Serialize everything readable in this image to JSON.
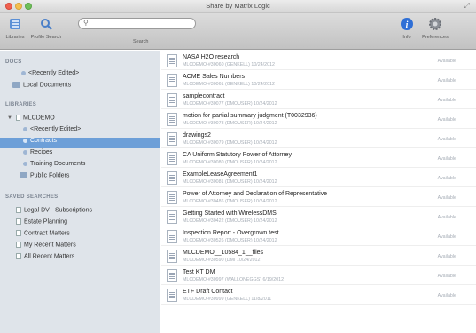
{
  "window": {
    "title": "Share by Matrix Logic"
  },
  "toolbar": {
    "libraries_label": "Libraries",
    "profile_search_label": "Profile Search",
    "search_placeholder": "",
    "search_label": "Search",
    "info_label": "Info",
    "preferences_label": "Preferences"
  },
  "sidebar": {
    "docs_header": "DOCS",
    "docs_items": [
      "<Recently Edited>",
      "Local Documents"
    ],
    "libraries_header": "LIBRARIES",
    "library_root": "MLCDEMO",
    "library_items": [
      "<Recently Edited>",
      "Contracts",
      "Recipes",
      "Training Documents",
      "Public Folders"
    ],
    "selected_item": "Contracts",
    "saved_header": "SAVED SEARCHES",
    "saved_items": [
      "Legal DV - Subscriptions",
      "Estate Planning",
      "Contract Matters",
      "My Recent Matters",
      "All Recent Matters"
    ]
  },
  "documents": [
    {
      "title": "NASA H2O research",
      "meta": "MLCDEMO-#30060 (GENKELL) 10/24/2012",
      "status": "Available"
    },
    {
      "title": "ACME Sales Numbers",
      "meta": "MLCDEMO-#30061 (GENKELL) 10/24/2012",
      "status": "Available"
    },
    {
      "title": "samplecontract",
      "meta": "MLCDEMO-#30077 (DMOUSER) 10/24/2012",
      "status": "Available"
    },
    {
      "title": "motion for partial summary judgment (T0032936)",
      "meta": "MLCDEMO-#30078 (DMOUSER) 10/24/2012",
      "status": "Available"
    },
    {
      "title": "drawings2",
      "meta": "MLCDEMO-#30079 (DMOUSER) 10/24/2012",
      "status": "Available"
    },
    {
      "title": "CA Uniform Statutory Power of Attorney",
      "meta": "MLCDEMO-#30080 (DMOUSER) 10/24/2012",
      "status": "Available"
    },
    {
      "title": "ExampleLeaseAgreement1",
      "meta": "MLCDEMO-#30081 (DMOUSER) 10/24/2012",
      "status": "Available"
    },
    {
      "title": "Power of Attorney and Declaration of Representative",
      "meta": "MLCDEMO-#30486 (DMOUSER) 10/24/2012",
      "status": "Available"
    },
    {
      "title": "Getting Started with WirelessDMS",
      "meta": "MLCDEMO-#30422 (DMOUSER) 10/24/2012",
      "status": "Available"
    },
    {
      "title": "Inspection Report - Overgrown test",
      "meta": "MLCDEMO-#30526 (DMOUSER) 10/24/2012",
      "status": "Available"
    },
    {
      "title": "MLCDEMO__10584_1__files",
      "meta": "MLCDEMO-#30590 (DMI 10/24/2012",
      "status": "Available"
    },
    {
      "title": "Test KT DM",
      "meta": "MLCDEMO-#30997 (WALLONEGGS) 6/19/2012",
      "status": "Available"
    },
    {
      "title": "ETF Draft Contact",
      "meta": "MLCDEMO-#30999 (GENKELL) 11/8/2011",
      "status": "Available"
    }
  ],
  "colors": {
    "selection": "#6d9fd8",
    "sidebar_bg": "#dfe4ea",
    "info_blue": "#2f6fd6"
  }
}
